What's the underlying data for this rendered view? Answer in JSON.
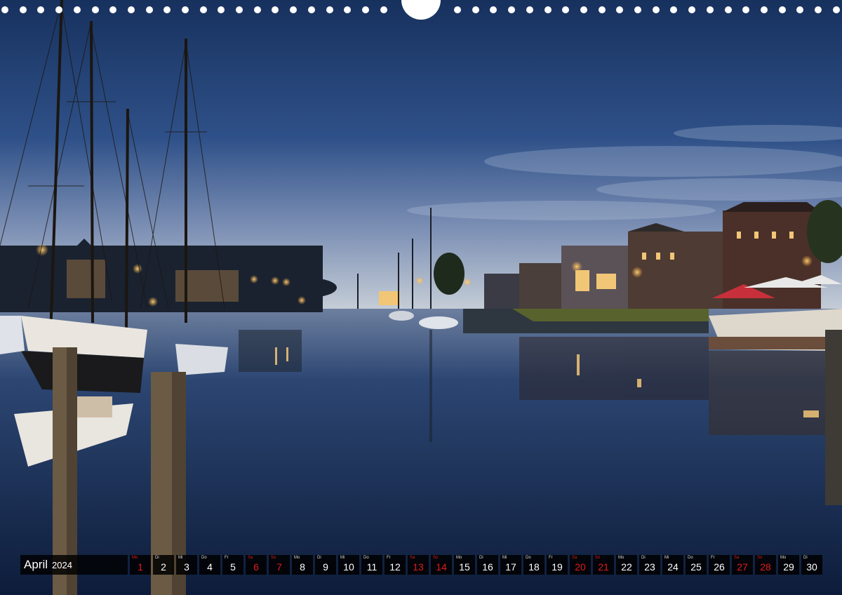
{
  "calendar": {
    "month": "April",
    "year": "2024",
    "days": [
      {
        "wd": "Mo",
        "n": "1",
        "red": true
      },
      {
        "wd": "Di",
        "n": "2",
        "red": false
      },
      {
        "wd": "Mi",
        "n": "3",
        "red": false
      },
      {
        "wd": "Do",
        "n": "4",
        "red": false
      },
      {
        "wd": "Fr",
        "n": "5",
        "red": false
      },
      {
        "wd": "Sa",
        "n": "6",
        "red": true
      },
      {
        "wd": "So",
        "n": "7",
        "red": true
      },
      {
        "wd": "Mo",
        "n": "8",
        "red": false
      },
      {
        "wd": "Di",
        "n": "9",
        "red": false
      },
      {
        "wd": "Mi",
        "n": "10",
        "red": false
      },
      {
        "wd": "Do",
        "n": "11",
        "red": false
      },
      {
        "wd": "Fr",
        "n": "12",
        "red": false
      },
      {
        "wd": "Sa",
        "n": "13",
        "red": true
      },
      {
        "wd": "So",
        "n": "14",
        "red": true
      },
      {
        "wd": "Mo",
        "n": "15",
        "red": false
      },
      {
        "wd": "Di",
        "n": "16",
        "red": false
      },
      {
        "wd": "Mi",
        "n": "17",
        "red": false
      },
      {
        "wd": "Do",
        "n": "18",
        "red": false
      },
      {
        "wd": "Fr",
        "n": "19",
        "red": false
      },
      {
        "wd": "Sa",
        "n": "20",
        "red": true
      },
      {
        "wd": "So",
        "n": "21",
        "red": true
      },
      {
        "wd": "Mo",
        "n": "22",
        "red": false
      },
      {
        "wd": "Di",
        "n": "23",
        "red": false
      },
      {
        "wd": "Mi",
        "n": "24",
        "red": false
      },
      {
        "wd": "Do",
        "n": "25",
        "red": false
      },
      {
        "wd": "Fr",
        "n": "26",
        "red": false
      },
      {
        "wd": "Sa",
        "n": "27",
        "red": true
      },
      {
        "wd": "So",
        "n": "28",
        "red": true
      },
      {
        "wd": "Mo",
        "n": "29",
        "red": false
      },
      {
        "wd": "Di",
        "n": "30",
        "red": false
      }
    ]
  },
  "colors": {
    "weekend": "#e01b1b",
    "sky_top": "#1e3b6e",
    "sky_horizon": "#b7c3d3",
    "water": "#0f2142"
  }
}
